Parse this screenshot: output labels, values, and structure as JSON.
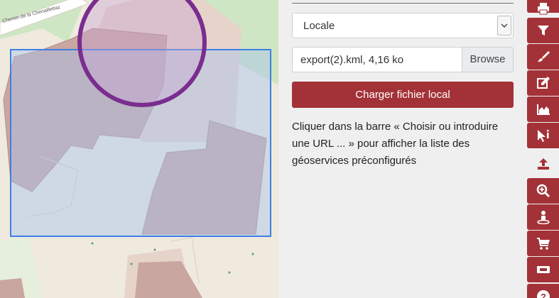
{
  "map": {
    "street_label": "Chemin de la Chenaillettaz"
  },
  "panel": {
    "source_select": {
      "value": "Locale"
    },
    "file": {
      "name": "export(2).kml, 4,16 ko",
      "browse_label": "Browse"
    },
    "load_button_label": "Charger fichier local",
    "help_text": "Cliquer dans la barre « Choisir ou introduire une URL ... » pour afficher la liste des géoservices préconfigurés"
  },
  "toolbar": {
    "items": [
      {
        "icon": "printer-icon"
      },
      {
        "icon": "filter-icon"
      },
      {
        "icon": "paintbrush-icon"
      },
      {
        "icon": "edit-icon"
      },
      {
        "icon": "area-chart-icon"
      },
      {
        "icon": "pointer-info-icon"
      },
      {
        "icon": "upload-icon",
        "active": true
      },
      {
        "icon": "zoom-in-icon"
      },
      {
        "icon": "streetview-icon"
      },
      {
        "icon": "cart-icon"
      },
      {
        "icon": "ticket-icon"
      },
      {
        "icon": "help-icon"
      }
    ]
  },
  "colors": {
    "accent": "#a33238",
    "panel_bg": "#efefef",
    "selection_rect": "#3f7fe6",
    "circle": "#7a2d8f"
  }
}
